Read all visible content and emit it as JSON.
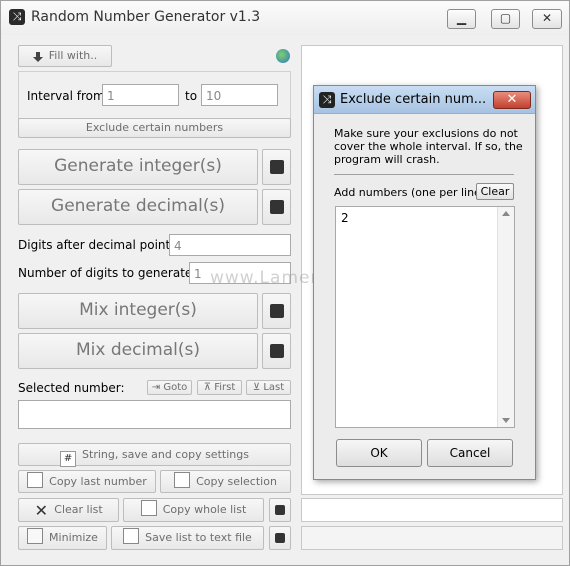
{
  "window": {
    "title": "Random Number Generator v1.3",
    "minimize_glyph": "▁",
    "maximize_glyph": "▢",
    "close_glyph": "✕"
  },
  "toolbar": {
    "fill_with": "Fill with.."
  },
  "interval": {
    "from_label": "Interval from",
    "from_value": "1",
    "to_label": "to",
    "to_value": "10",
    "exclude_button": "Exclude certain numbers"
  },
  "generate": {
    "integer": "Generate integer(s)",
    "decimal": "Generate decimal(s)"
  },
  "digits_after_decimal": {
    "label": "Digits after decimal point:",
    "value": "4"
  },
  "digits_to_generate": {
    "label": "Number of digits to generate:",
    "value": "1"
  },
  "mix": {
    "integer": "Mix integer(s)",
    "decimal": "Mix decimal(s)"
  },
  "selected": {
    "label": "Selected number:",
    "goto": "Goto",
    "first": "First",
    "last": "Last",
    "value": ""
  },
  "actions": {
    "settings": "String, save and copy settings",
    "copy_last": "Copy last number",
    "copy_selection": "Copy selection",
    "clear_list": "Clear list",
    "copy_whole_list": "Copy whole list",
    "minimize": "Minimize",
    "save_list": "Save list to text file"
  },
  "dialog": {
    "title": "Exclude certain num...",
    "close_glyph": "✕",
    "message": "Make sure your exclusions do not cover the whole interval. If so, the program will crash.",
    "add_label": "Add numbers (one per line):",
    "clear": "Clear",
    "text": "2",
    "ok": "OK",
    "cancel": "Cancel"
  },
  "watermark": "www.LamerKomp.ru"
}
